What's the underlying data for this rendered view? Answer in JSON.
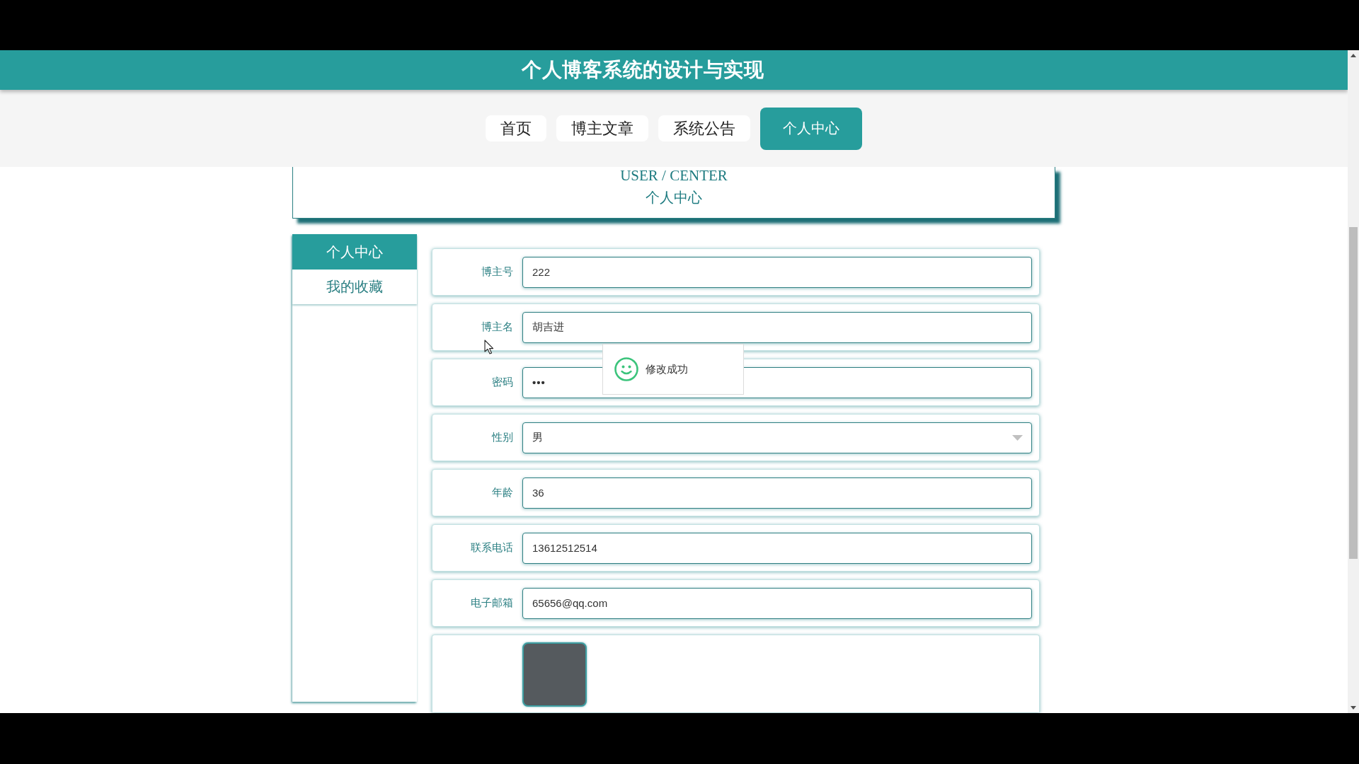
{
  "header": {
    "title": "个人博客系统的设计与实现"
  },
  "nav": [
    {
      "label": "首页",
      "selected": false
    },
    {
      "label": "博主文章",
      "selected": false
    },
    {
      "label": "系统公告",
      "selected": false
    },
    {
      "label": "个人中心",
      "selected": true
    }
  ],
  "banner": {
    "title": "USER / CENTER",
    "subtitle": "个人中心"
  },
  "sidebar": {
    "items": [
      {
        "label": "个人中心",
        "selected": true
      },
      {
        "label": "我的收藏",
        "selected": false
      }
    ]
  },
  "form": {
    "fields": [
      {
        "kind": "text",
        "label": "博主号",
        "value": "222"
      },
      {
        "kind": "text",
        "label": "博主名",
        "value": "胡吉进"
      },
      {
        "kind": "password",
        "label": "密码",
        "value": "•••"
      },
      {
        "kind": "select",
        "label": "性别",
        "value": "男"
      },
      {
        "kind": "text",
        "label": "年龄",
        "value": "36"
      },
      {
        "kind": "text",
        "label": "联系电话",
        "value": "13612512514"
      },
      {
        "kind": "text",
        "label": "电子邮箱",
        "value": "65656@qq.com"
      },
      {
        "kind": "image"
      }
    ]
  },
  "toast": {
    "message": "修改成功"
  }
}
